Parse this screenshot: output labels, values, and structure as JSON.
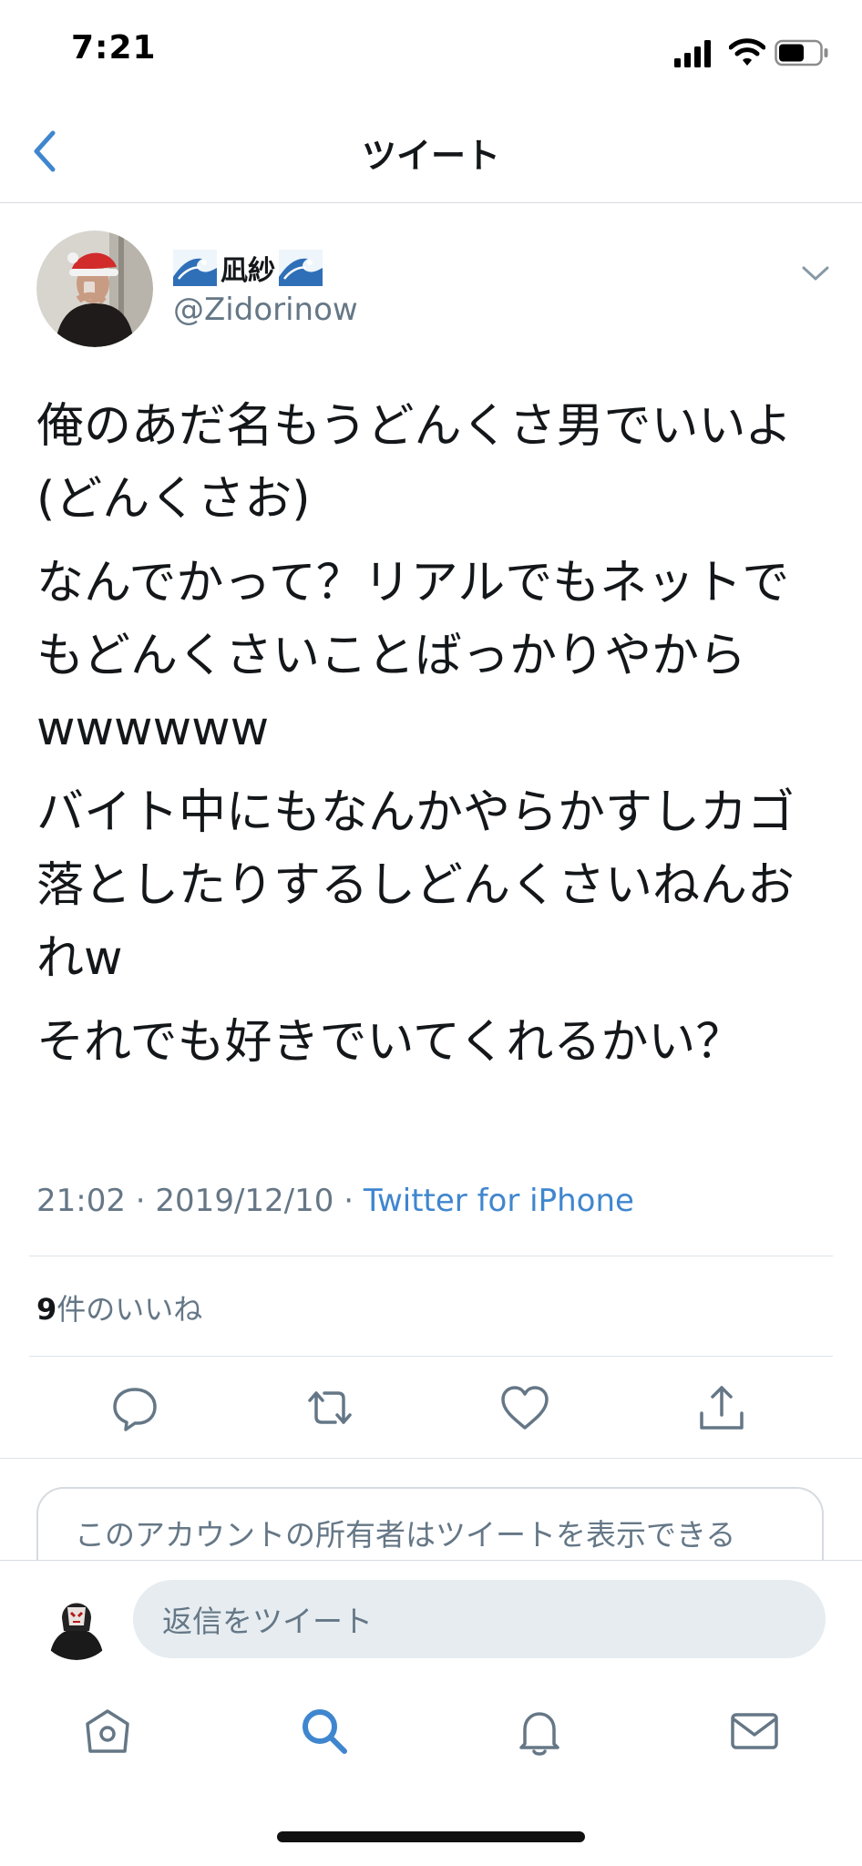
{
  "status_bar": {
    "time": "7:21"
  },
  "nav": {
    "title": "ツイート"
  },
  "tweet": {
    "display_name": "凪紗",
    "handle": "@Zidorinow",
    "paragraphs": [
      "俺のあだ名もうどんくさ男でいいよ(どんくさお)",
      "なんでかって？リアルでもネットでもどんくさいことばっかりやからwwwwww",
      "バイト中にもなんかやらかすしカゴ落としたりするしどんくさいねんおれw",
      "それでも好きでいてくれるかい？"
    ],
    "time": "21:02",
    "date": "2019/12/10",
    "source": "Twitter for iPhone",
    "separator": "·",
    "likes_count": "9",
    "likes_label": "件のいいね"
  },
  "notice": {
    "text": "このアカウントの所有者はツイートを表示できる"
  },
  "compose": {
    "placeholder": "返信をツイート"
  },
  "icons": {
    "back": "chevron-left-icon",
    "menu": "chevron-down-icon",
    "reply": "speech-bubble-icon",
    "retweet": "retweet-icon",
    "like": "heart-icon",
    "share": "share-icon",
    "home": "home-icon",
    "search": "search-icon",
    "notifications": "bell-icon",
    "messages": "envelope-icon"
  },
  "colors": {
    "accent": "#3f86cf",
    "text_primary": "#14171a",
    "text_secondary": "#657786",
    "divider": "#dfe3e8",
    "input_bg": "#e6ecf0"
  }
}
